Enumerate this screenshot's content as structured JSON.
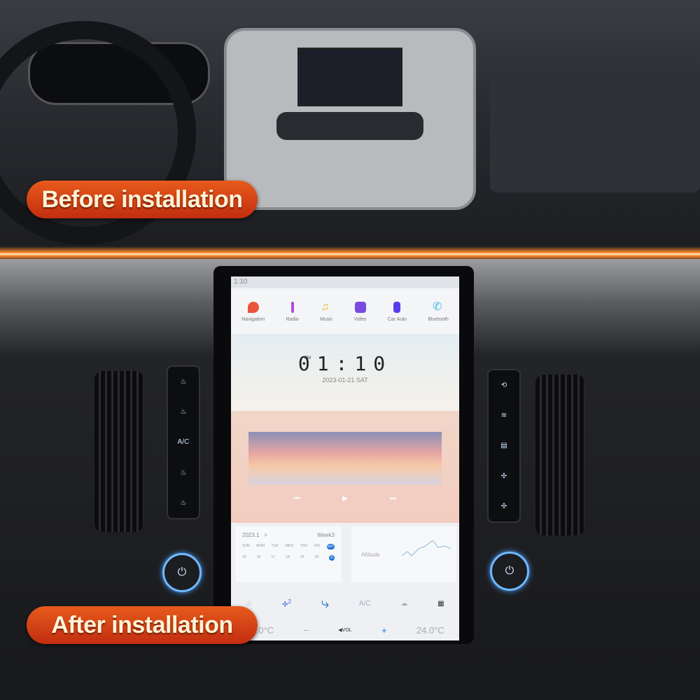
{
  "labels": {
    "before": "Before installation",
    "after": "After installation"
  },
  "screen": {
    "status_time": "1:10",
    "apps": [
      {
        "label": "Navigation",
        "icon": "map-pin-icon",
        "color": "#e8553a"
      },
      {
        "label": "Radio",
        "icon": "radio-antenna-icon",
        "color": "#b24bd8"
      },
      {
        "label": "Music",
        "icon": "music-note-icon",
        "color": "#f0b62a"
      },
      {
        "label": "Video",
        "icon": "video-play-icon",
        "color": "#7a4be0"
      },
      {
        "label": "Car Auto",
        "icon": "car-auto-icon",
        "color": "#5a3cf0"
      },
      {
        "label": "Bluetooth",
        "icon": "phone-icon",
        "color": "#3fb6e8"
      }
    ],
    "clock": {
      "ampm": "PM",
      "time": "01:10",
      "date": "2023-01-21  SAT"
    },
    "media": {
      "prev": "⏮",
      "play": "▶",
      "next": "⏭"
    },
    "calendar": {
      "month": "2023.1",
      "chevron": ">",
      "week": "Week3",
      "days": [
        "SUN",
        "MON",
        "TUE",
        "WED",
        "THU",
        "FRI",
        "SAT"
      ],
      "dates": [
        "15",
        "16",
        "17",
        "18",
        "19",
        "20",
        "21"
      ],
      "selected_index": 6,
      "accent": "#1a73d8"
    },
    "altitude": {
      "label": "Altitude"
    },
    "climate": {
      "fan_level": "2",
      "ac": "A/C",
      "left_temp": "23.0°C",
      "minus": "−",
      "vol": "VOL",
      "plus": "+",
      "right_temp": "24.0°C"
    }
  },
  "left_buttons": [
    "",
    "",
    "A/C",
    "",
    ""
  ],
  "power_symbol": "⏻"
}
